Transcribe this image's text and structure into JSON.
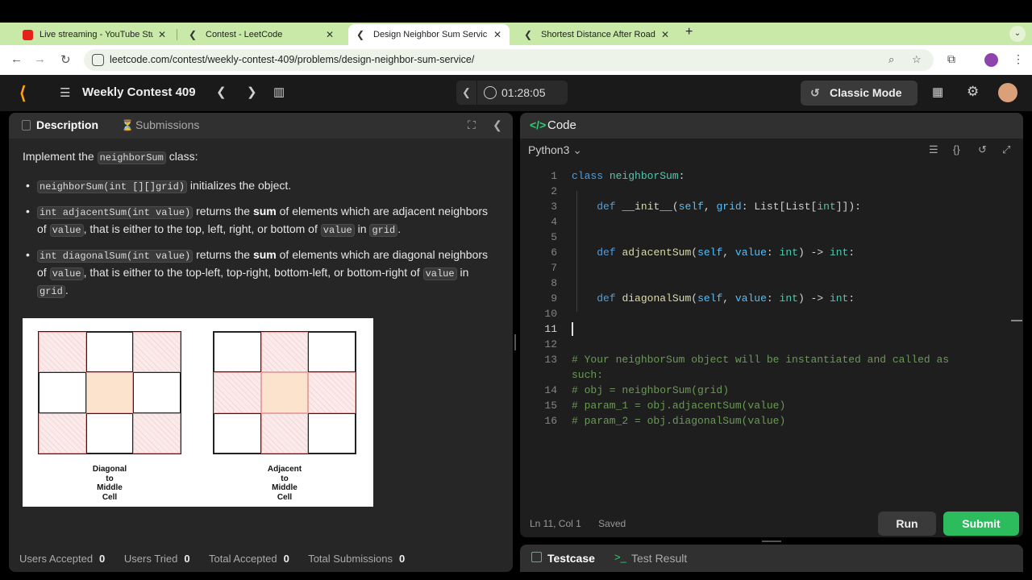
{
  "browser": {
    "tabs": [
      {
        "title": "Live streaming - YouTube Stu",
        "favicon": "youtube-icon",
        "active": false
      },
      {
        "title": "Contest - LeetCode",
        "favicon": "leetcode-icon",
        "active": false
      },
      {
        "title": "Design Neighbor Sum Servic",
        "favicon": "leetcode-icon",
        "active": true
      },
      {
        "title": "Shortest Distance After Road",
        "favicon": "leetcode-icon",
        "active": false
      }
    ],
    "url": "leetcode.com/contest/weekly-contest-409/problems/design-neighbor-sum-service/"
  },
  "header": {
    "contest_title": "Weekly Contest 409",
    "timer": "01:28:05",
    "classic_mode": "Classic Mode"
  },
  "left": {
    "tab_description": "Description",
    "tab_submissions": "Submissions",
    "intro_pre": "Implement the ",
    "intro_code": "neighborSum",
    "intro_post": " class:",
    "b1_code": "neighborSum(int [][]grid)",
    "b1_text": " initializes the object.",
    "b2_code": "int adjacentSum(int value)",
    "b2_t1": " returns the ",
    "b2_sum": "sum",
    "b2_t2": " of elements which are adjacent neighbors of ",
    "b2_c2": "value",
    "b2_t3": ", that is either to the top, left, right, or bottom of ",
    "b2_c3": "value",
    "b2_t4": " in ",
    "b2_c4": "grid",
    "b2_t5": ".",
    "b3_code": "int diagonalSum(int value)",
    "b3_t1": " returns the ",
    "b3_sum": "sum",
    "b3_t2": " of elements which are diagonal neighbors of ",
    "b3_c2": "value",
    "b3_t3": ", that is either to the top-left, top-right, bottom-left, or bottom-right of ",
    "b3_c3": "value",
    "b3_t4": " in ",
    "b3_c4": "grid",
    "b3_t5": ".",
    "fig_caption_left": [
      "Diagonal",
      "to",
      "Middle",
      "Cell"
    ],
    "fig_caption_right": [
      "Adjacent",
      "to",
      "Middle",
      "Cell"
    ],
    "stats": [
      {
        "label": "Users Accepted",
        "value": "0"
      },
      {
        "label": "Users Tried",
        "value": "0"
      },
      {
        "label": "Total Accepted",
        "value": "0"
      },
      {
        "label": "Total Submissions",
        "value": "0"
      }
    ]
  },
  "right": {
    "title": "Code",
    "language": "Python3",
    "status_pos": "Ln 11, Col 1",
    "status_saved": "Saved",
    "run": "Run",
    "submit": "Submit",
    "testcase": "Testcase",
    "test_result": "Test Result",
    "line_numbers": [
      "1",
      "2",
      "3",
      "4",
      "5",
      "6",
      "7",
      "8",
      "9",
      "10",
      "11",
      "12",
      "13",
      "14",
      "15",
      "16"
    ]
  },
  "colors": {
    "accent": "#ffa116",
    "submit_green": "#2cbb5d",
    "link_blue": "#3b82f6"
  }
}
